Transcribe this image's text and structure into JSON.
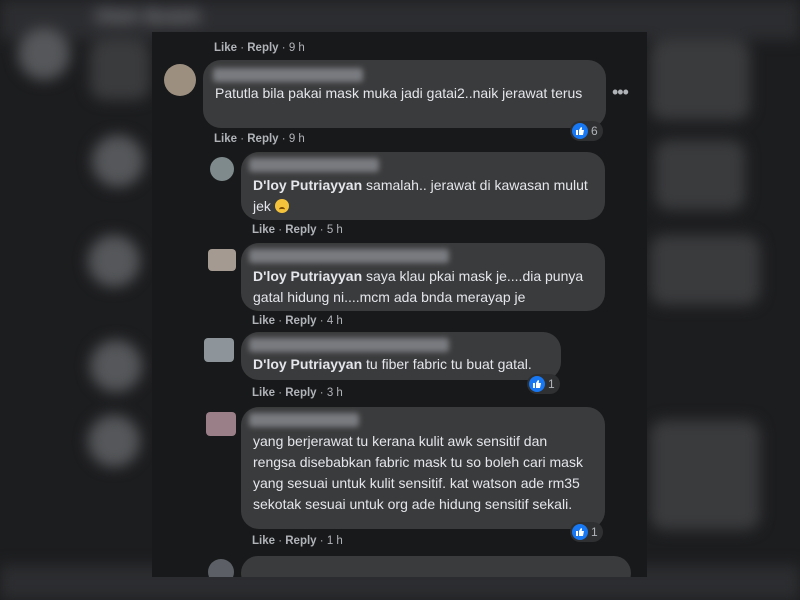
{
  "page_title_blurred": "Oleh Boleh",
  "top_comment": {
    "actions": {
      "like": "Like",
      "reply": "Reply",
      "time": "9 h"
    }
  },
  "comments": [
    {
      "text": "Patutla bila pakai mask muka jadi gatai2..naik jerawat terus",
      "like": "Like",
      "reply": "Reply",
      "time": "9 h",
      "reactions": "6"
    },
    {
      "author": "D'loy Putriayyan",
      "text": " samalah.. jerawat di kawasan mulut jek",
      "like": "Like",
      "reply": "Reply",
      "time": "5 h"
    },
    {
      "author": "D'loy Putriayyan",
      "text": " saya klau pkai mask je....dia punya gatal hidung ni....mcm ada bnda merayap je",
      "like": "Like",
      "reply": "Reply",
      "time": "4 h"
    },
    {
      "author": "D'loy Putriayyan",
      "text": " tu fiber fabric tu buat gatal.",
      "like": "Like",
      "reply": "Reply",
      "time": "3 h",
      "reactions": "1"
    },
    {
      "text": "yang berjerawat tu kerana kulit awk sensitif dan rengsa disebabkan fabric mask tu so boleh cari mask yang sesuai untuk kulit sensitif. kat watson ade rm35 sekotak sesuai untuk org ade hidung sensitif sekali.",
      "like": "Like",
      "reply": "Reply",
      "time": "1 h",
      "reactions": "1"
    }
  ],
  "colors": {
    "like_blue": "#1877f2",
    "bubble": "#3a3b3c",
    "panel": "#18191a"
  },
  "icons": [
    "like-icon",
    "more-options-icon",
    "laughing-crying-emoji"
  ]
}
